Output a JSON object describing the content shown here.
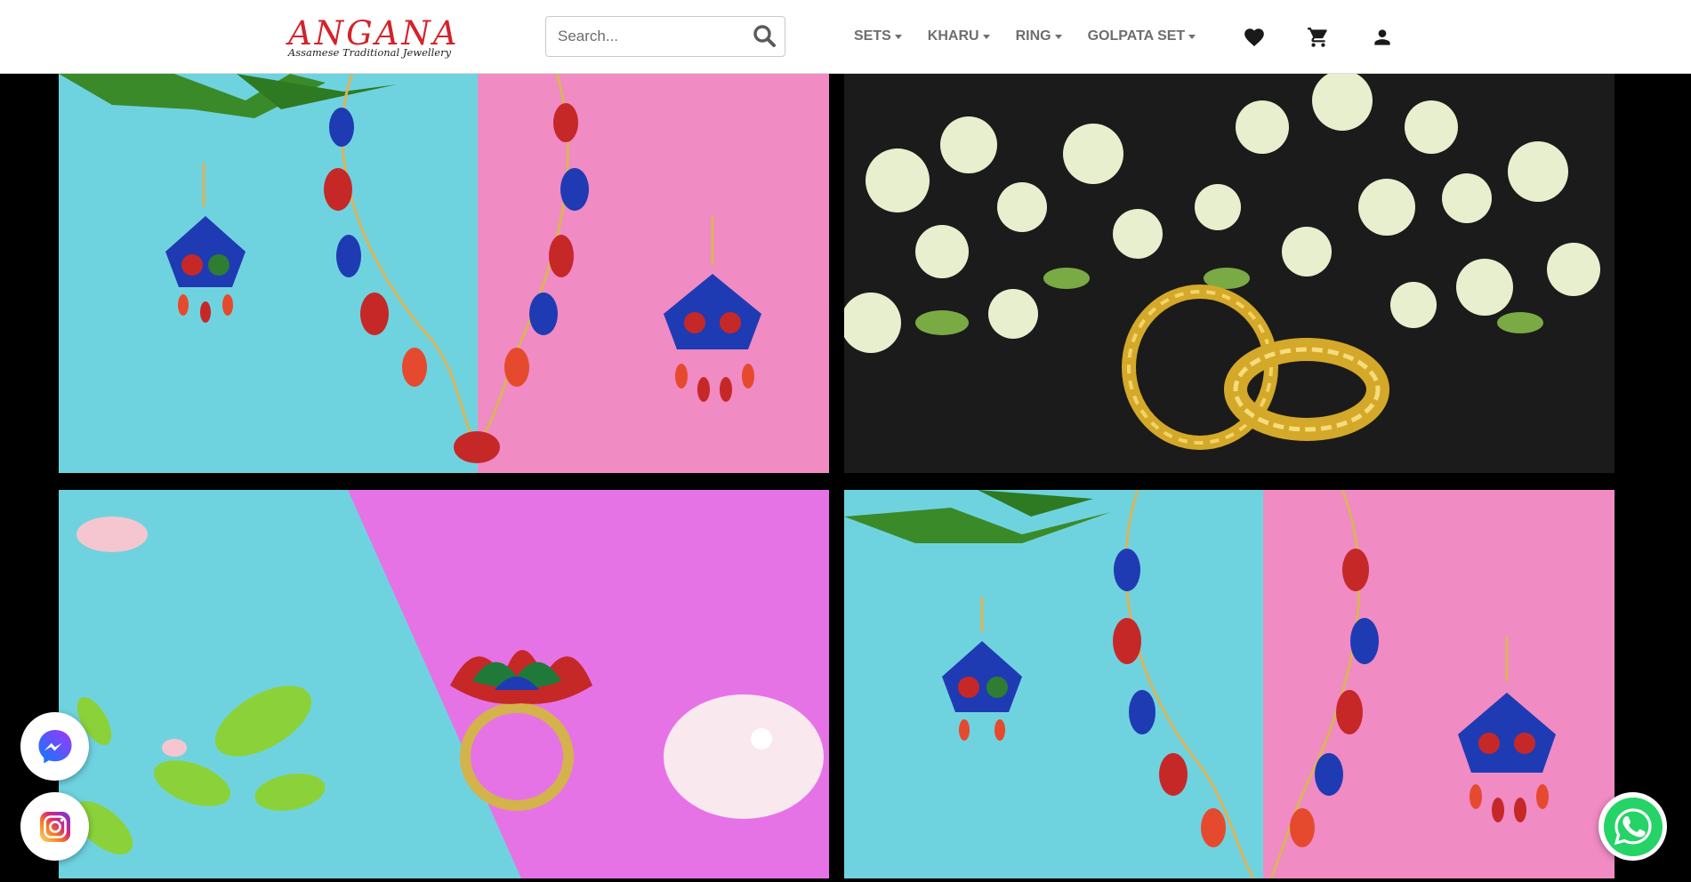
{
  "brand": {
    "name": "ANGANA",
    "tagline": "Assamese Traditional Jewellery",
    "accent": "#d2232a"
  },
  "search": {
    "placeholder": "Search...",
    "value": "",
    "icon": "search-icon"
  },
  "nav": {
    "items": [
      {
        "label": "SETS"
      },
      {
        "label": "KHARU"
      },
      {
        "label": "RING"
      },
      {
        "label": "GOLPATA SET"
      }
    ]
  },
  "header_icons": [
    "heart-icon",
    "cart-icon",
    "user-icon"
  ],
  "gallery": [
    {
      "name": "gallery-image-necklace-set",
      "background": "cyan-pink"
    },
    {
      "name": "gallery-image-kharu-bangles",
      "background": "dark"
    },
    {
      "name": "gallery-image-lotus-ring",
      "background": "cyan-magenta"
    },
    {
      "name": "gallery-image-necklace-set-2",
      "background": "cyan-pink"
    }
  ],
  "floating": {
    "messenger_icon": "messenger-icon",
    "instagram_icon": "instagram-icon",
    "whatsapp_icon": "whatsapp-icon",
    "whatsapp_color": "#25d366"
  },
  "colors": {
    "header_bg": "#ffffff",
    "page_bg": "#000000",
    "nav_text": "#6e6e6e",
    "icon": "#1a1a1a"
  }
}
